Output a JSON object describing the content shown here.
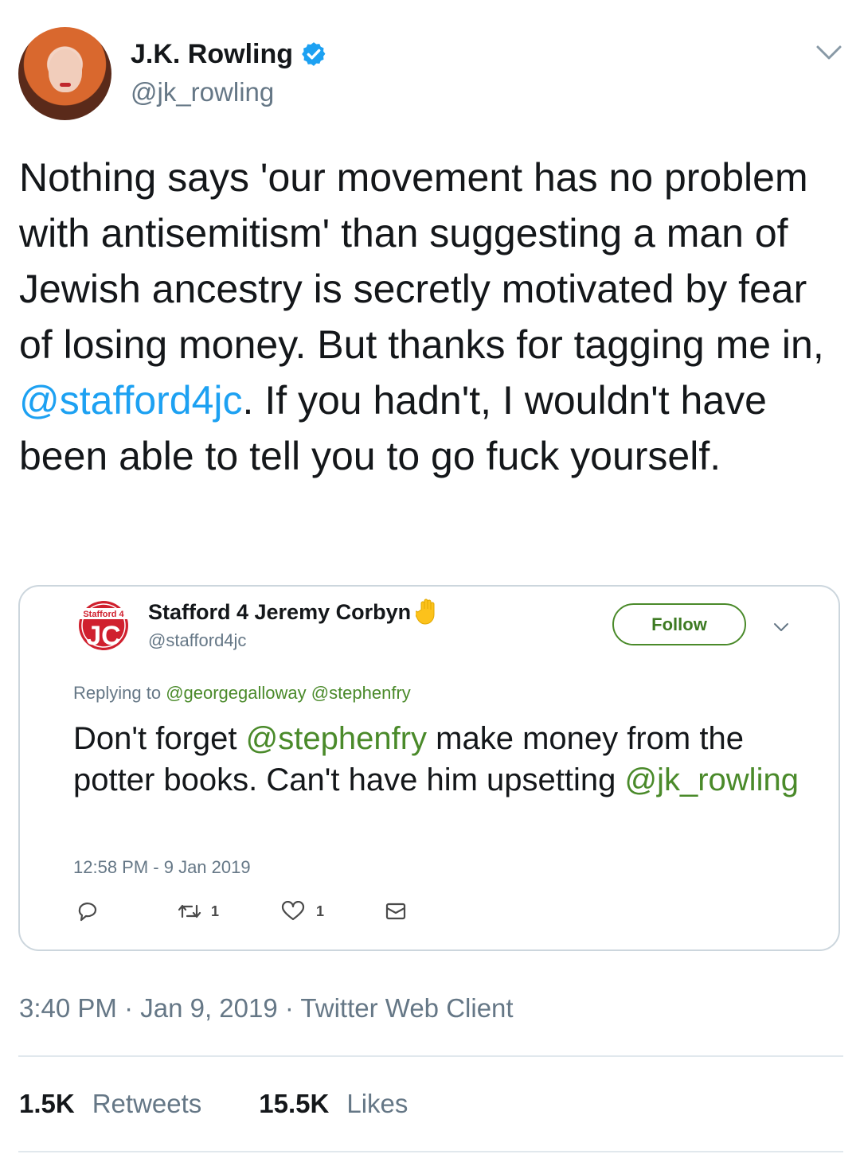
{
  "author": {
    "display_name": "J.K. Rowling",
    "handle": "@jk_rowling",
    "verified": true
  },
  "tweet": {
    "text_part1": "Nothing says 'our movement has no problem with antisemitism' than suggesting a man of Jewish ancestry is secretly motivated by fear of losing money. But thanks for tagging me in, ",
    "mention": "@stafford4jc",
    "text_part2": ". If you hadn't, I wouldn't have been able to tell you to go fuck yourself."
  },
  "embedded_screenshot": {
    "logo_small_text": "Stafford 4",
    "logo_letters": "JC",
    "display_name": "Stafford 4 Jeremy Corbyn",
    "handle": "@stafford4jc",
    "follow_label": "Follow",
    "replying_prefix": "Replying to ",
    "replying_to": "@georgegalloway @stephenfry",
    "text_part1": "Don't forget ",
    "mention1": "@stephenfry",
    "text_part2": " make money from the potter books. Can't have him upsetting ",
    "mention2": "@jk_rowling",
    "timestamp": "12:58 PM - 9 Jan 2019",
    "retweet_count": "1",
    "like_count": "1"
  },
  "meta": {
    "timestamp": "3:40 PM · Jan 9, 2019 · Twitter Web Client"
  },
  "stats": {
    "retweets_count": "1.5K",
    "retweets_label": "Retweets",
    "likes_count": "15.5K",
    "likes_label": "Likes"
  },
  "colors": {
    "link_blue": "#1da1f2",
    "secondary_gray": "#657786",
    "embedded_green": "#4a8a2a",
    "logo_red": "#d0202e"
  }
}
